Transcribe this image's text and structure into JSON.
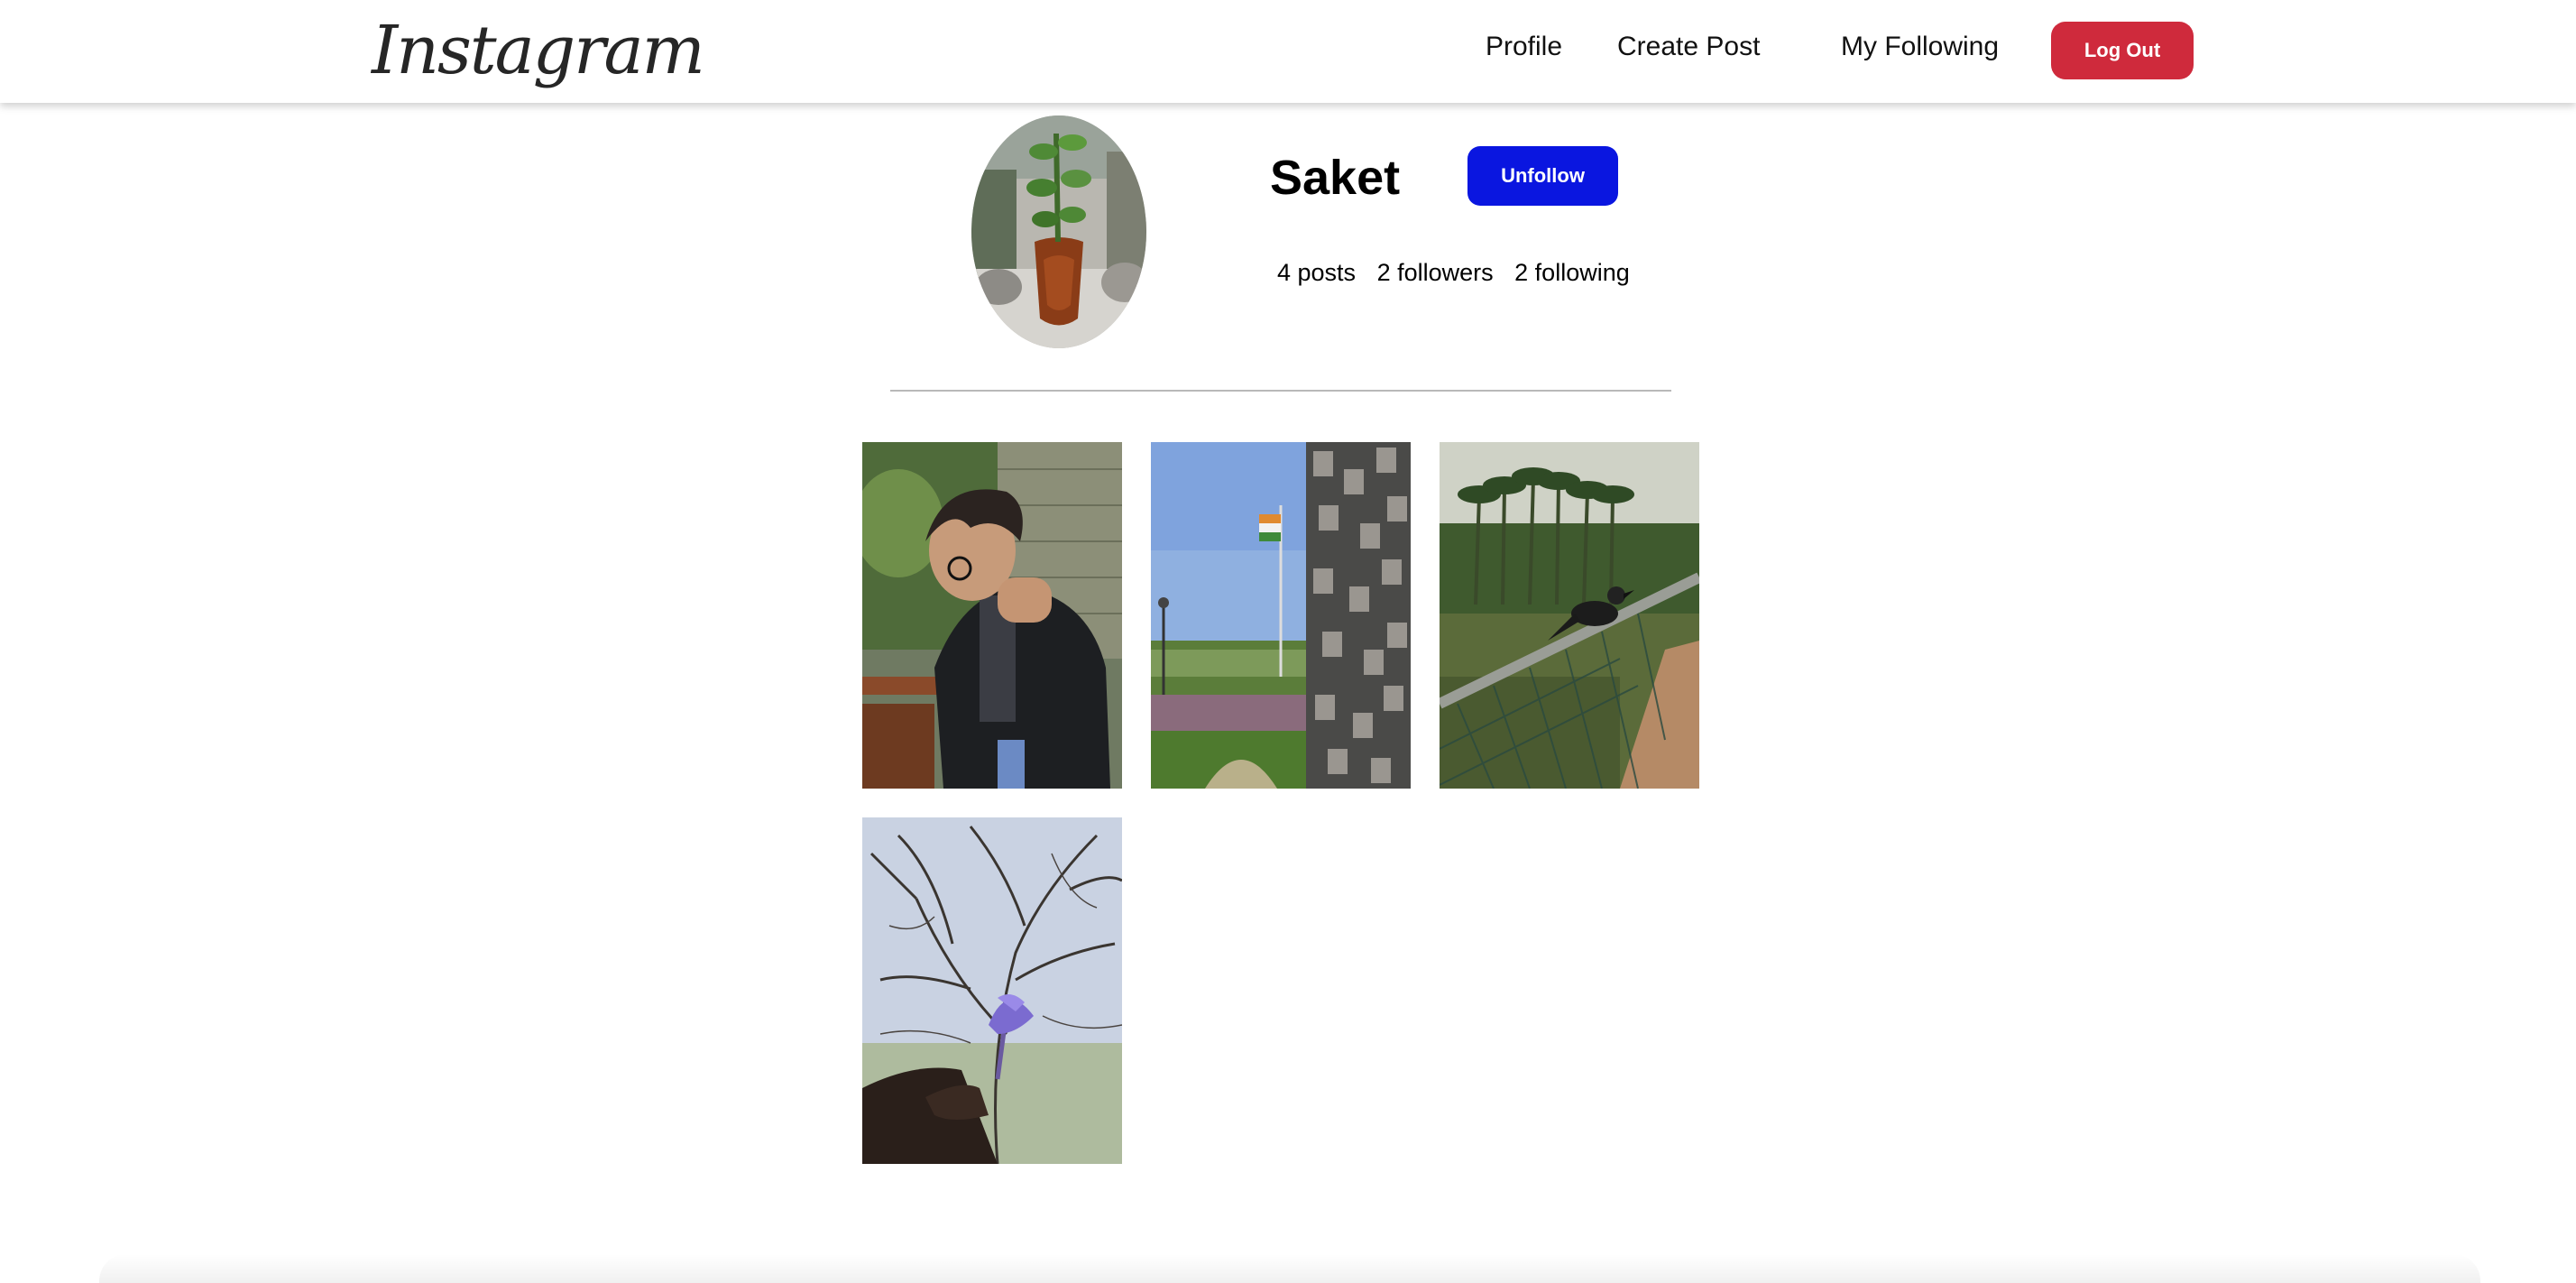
{
  "navbar": {
    "logo_text": "Instagram",
    "links": {
      "profile": "Profile",
      "create_post": "Create Post",
      "my_following": "My Following"
    },
    "logout_label": "Log Out",
    "logout_color": "#cf2a3c"
  },
  "profile": {
    "username": "Saket",
    "follow_button_label": "Unfollow",
    "follow_button_color": "#0a16e0",
    "avatar_icon": "profile-photo-plant-pot",
    "stats": {
      "posts": "4 posts",
      "followers": "2 followers",
      "following": "2 following"
    }
  },
  "posts": [
    {
      "subject": "person-in-black-jacket"
    },
    {
      "subject": "flagpole-and-garden"
    },
    {
      "subject": "crow-on-railing-by-lake"
    },
    {
      "subject": "purple-flower-against-tree"
    }
  ]
}
